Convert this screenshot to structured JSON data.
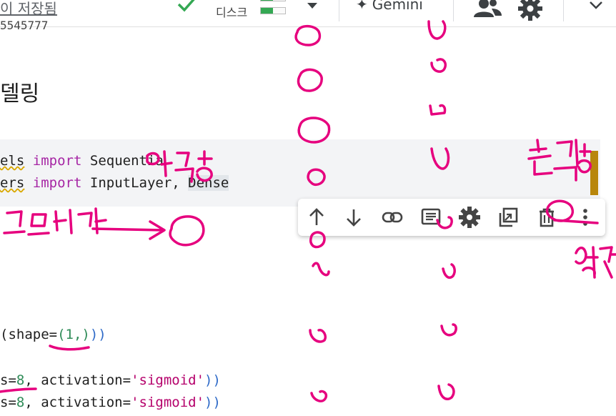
{
  "header": {
    "saved_status": "이 저장됨",
    "disk_label": "디스크",
    "disk_usage": 0.5,
    "gemini_label": "Gemini",
    "icons": [
      "check-icon",
      "chevron-down-icon",
      "sparkle-icon",
      "people-icon",
      "gear-icon",
      "chevron-down-icon"
    ],
    "colors": {
      "check": "#34a853",
      "brand_dark": "#3c4043"
    }
  },
  "notebook": {
    "partial_output": "5545777",
    "section_heading": "델링",
    "imports": {
      "line1": {
        "prefix": "els",
        "kw": "import",
        "rest": "Sequentia"
      },
      "line2": {
        "prefix": "ers",
        "kw": "import",
        "rest_a": "InputLayer,",
        "rest_b": "Dense"
      }
    },
    "code_lines": {
      "l1": {
        "a": "(shape=",
        "b": "(1,)",
        "c": "))"
      },
      "l2": {
        "a": "s=",
        "num": "8",
        "b": ", activation=",
        "s": "'sigmoid'",
        "c": "))"
      },
      "l3": {
        "a": "s=",
        "num": "8",
        "b": ", activation=",
        "s": "'sigmoid'",
        "c": "))"
      }
    }
  },
  "cell_toolbar": {
    "buttons": [
      "move-up",
      "move-down",
      "link",
      "comment",
      "settings",
      "mirror-cell",
      "delete",
      "more"
    ]
  },
  "annotations": {
    "color": "#e6007e",
    "words": [
      "입력층",
      "곱해라",
      "출력층",
      "상자"
    ]
  }
}
